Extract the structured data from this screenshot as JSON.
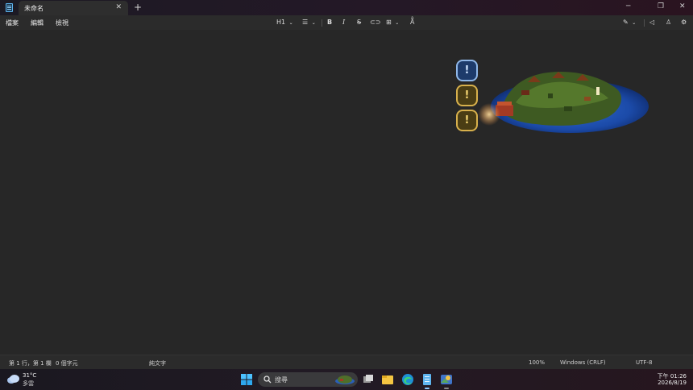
{
  "window": {
    "tab_title": "未命名",
    "tab_close": "✕",
    "new_tab": "+"
  },
  "menu": {
    "file": "檔案",
    "edit": "編輯",
    "view": "檢視"
  },
  "toolbar": {
    "heading": "H1",
    "bold": "B",
    "italic": "I",
    "strike": "S"
  },
  "widget": {
    "alert_mark": "!"
  },
  "status": {
    "position": "第 1 行，第 1 欄",
    "chars": "0 個字元",
    "mode": "純文字",
    "zoom": "100%",
    "line_ending": "Windows (CRLF)",
    "encoding": "UTF-8"
  },
  "taskbar": {
    "temperature": "31°C",
    "weather": "多雲",
    "search_placeholder": "搜尋",
    "time": "下午 01:26",
    "date": "2026/8/19"
  },
  "colors": {
    "accent": "#5eb4ef",
    "alert_yellow": "#d7b04c",
    "alert_blue": "#8fb7e8"
  }
}
